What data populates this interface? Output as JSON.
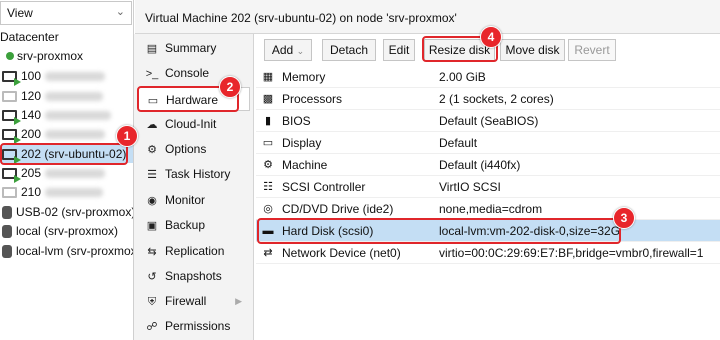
{
  "tree": {
    "view_label": "View",
    "items": [
      {
        "label": "Datacenter",
        "kind": "datacenter"
      },
      {
        "label": "srv-proxmox",
        "kind": "node"
      },
      {
        "label": "100",
        "kind": "vm",
        "state": "running"
      },
      {
        "label": "120",
        "kind": "vm",
        "state": "stopped"
      },
      {
        "label": "140",
        "kind": "vm",
        "state": "running"
      },
      {
        "label": "200",
        "kind": "vm",
        "state": "running"
      },
      {
        "label": "202 (srv-ubuntu-02)",
        "kind": "vm",
        "state": "selected"
      },
      {
        "label": "205",
        "kind": "vm",
        "state": "running"
      },
      {
        "label": "210",
        "kind": "vm",
        "state": "stopped"
      },
      {
        "label": "USB-02 (srv-proxmox)",
        "kind": "storage"
      },
      {
        "label": "local (srv-proxmox)",
        "kind": "storage"
      },
      {
        "label": "local-lvm (srv-proxmox)",
        "kind": "storage"
      }
    ]
  },
  "header": {
    "title": "Virtual Machine 202 (srv-ubuntu-02) on node 'srv-proxmox'"
  },
  "nav": [
    {
      "label": "Summary",
      "icon": "summary-icon"
    },
    {
      "label": "Console",
      "icon": "console-icon"
    },
    {
      "label": "Hardware",
      "icon": "monitor-icon"
    },
    {
      "label": "Cloud-Init",
      "icon": "cloud-icon"
    },
    {
      "label": "Options",
      "icon": "gear-icon"
    },
    {
      "label": "Task History",
      "icon": "list-icon"
    },
    {
      "label": "Monitor",
      "icon": "eye-icon"
    },
    {
      "label": "Backup",
      "icon": "floppy-icon"
    },
    {
      "label": "Replication",
      "icon": "retweet-icon"
    },
    {
      "label": "Snapshots",
      "icon": "history-icon"
    },
    {
      "label": "Firewall",
      "icon": "shield-icon"
    },
    {
      "label": "Permissions",
      "icon": "unlock-icon"
    }
  ],
  "toolbar": {
    "add": "Add",
    "detach": "Detach",
    "edit": "Edit",
    "resize": "Resize disk",
    "move": "Move disk",
    "revert": "Revert"
  },
  "hardware": [
    {
      "key": "Memory",
      "value": "2.00 GiB",
      "icon": "memory-icon"
    },
    {
      "key": "Processors",
      "value": "2 (1 sockets, 2 cores)",
      "icon": "cpu-icon"
    },
    {
      "key": "BIOS",
      "value": "Default (SeaBIOS)",
      "icon": "microchip-icon"
    },
    {
      "key": "Display",
      "value": "Default",
      "icon": "desktop-icon"
    },
    {
      "key": "Machine",
      "value": "Default (i440fx)",
      "icon": "cogs-icon"
    },
    {
      "key": "SCSI Controller",
      "value": "VirtIO SCSI",
      "icon": "database-icon"
    },
    {
      "key": "CD/DVD Drive (ide2)",
      "value": "none,media=cdrom",
      "icon": "cdrom-icon"
    },
    {
      "key": "Hard Disk (scsi0)",
      "value": "local-lvm:vm-202-disk-0,size=32G",
      "icon": "hdd-icon"
    },
    {
      "key": "Network Device (net0)",
      "value": "virtio=00:0C:29:69:E7:BF,bridge=vmbr0,firewall=1",
      "icon": "exchange-icon"
    }
  ],
  "badges": [
    "1",
    "2",
    "3",
    "4"
  ],
  "colors": {
    "selection": "#c4def4",
    "callout": "#e0262b",
    "running": "#3ca03c"
  }
}
